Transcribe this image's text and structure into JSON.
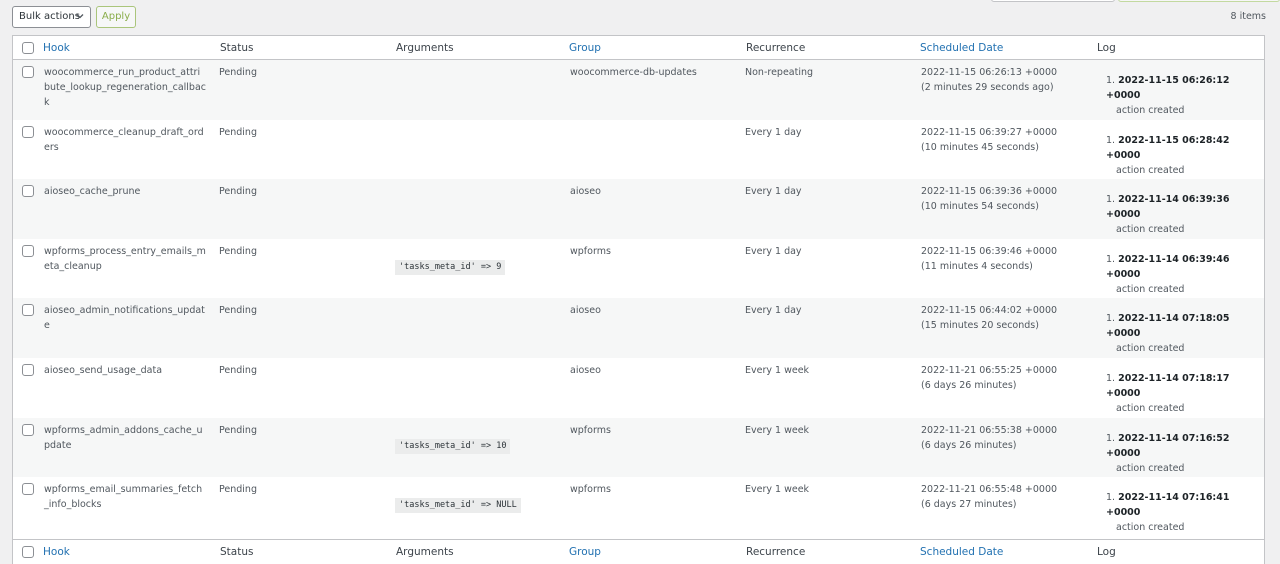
{
  "toolbar": {
    "bulk_actions_label": "Bulk actions",
    "apply_label": "Apply",
    "items_count": "8 items"
  },
  "columns": {
    "hook": "Hook",
    "status": "Status",
    "arguments": "Arguments",
    "group": "Group",
    "recurrence": "Recurrence",
    "scheduled_date": "Scheduled Date",
    "log": "Log"
  },
  "rows": [
    {
      "hook": "woocommerce_run_product_attribute_lookup_regeneration_callback",
      "status": "Pending",
      "arguments": "",
      "group": "woocommerce-db-updates",
      "recurrence": "Non-repeating",
      "scheduled": "2022-11-15 06:26:13 +0000",
      "scheduled_rel": "(2 minutes 29 seconds ago)",
      "log_number": "1.",
      "log_date": "2022-11-15 06:26:12 +0000",
      "log_msg": "action created"
    },
    {
      "hook": "woocommerce_cleanup_draft_orders",
      "status": "Pending",
      "arguments": "",
      "group": "",
      "recurrence": "Every 1 day",
      "scheduled": "2022-11-15 06:39:27 +0000",
      "scheduled_rel": "(10 minutes 45 seconds)",
      "log_number": "1.",
      "log_date": "2022-11-15 06:28:42 +0000",
      "log_msg": "action created"
    },
    {
      "hook": "aioseo_cache_prune",
      "status": "Pending",
      "arguments": "",
      "group": "aioseo",
      "recurrence": "Every 1 day",
      "scheduled": "2022-11-15 06:39:36 +0000",
      "scheduled_rel": "(10 minutes 54 seconds)",
      "log_number": "1.",
      "log_date": "2022-11-14 06:39:36 +0000",
      "log_msg": "action created"
    },
    {
      "hook": "wpforms_process_entry_emails_meta_cleanup",
      "status": "Pending",
      "arguments": "'tasks_meta_id' => 9",
      "group": "wpforms",
      "recurrence": "Every 1 day",
      "scheduled": "2022-11-15 06:39:46 +0000",
      "scheduled_rel": "(11 minutes 4 seconds)",
      "log_number": "1.",
      "log_date": "2022-11-14 06:39:46 +0000",
      "log_msg": "action created"
    },
    {
      "hook": "aioseo_admin_notifications_update",
      "status": "Pending",
      "arguments": "",
      "group": "aioseo",
      "recurrence": "Every 1 day",
      "scheduled": "2022-11-15 06:44:02 +0000",
      "scheduled_rel": "(15 minutes 20 seconds)",
      "log_number": "1.",
      "log_date": "2022-11-14 07:18:05 +0000",
      "log_msg": "action created"
    },
    {
      "hook": "aioseo_send_usage_data",
      "status": "Pending",
      "arguments": "",
      "group": "aioseo",
      "recurrence": "Every 1 week",
      "scheduled": "2022-11-21 06:55:25 +0000",
      "scheduled_rel": "(6 days 26 minutes)",
      "log_number": "1.",
      "log_date": "2022-11-14 07:18:17 +0000",
      "log_msg": "action created"
    },
    {
      "hook": "wpforms_admin_addons_cache_update",
      "status": "Pending",
      "arguments": "'tasks_meta_id' => 10",
      "group": "wpforms",
      "recurrence": "Every 1 week",
      "scheduled": "2022-11-21 06:55:38 +0000",
      "scheduled_rel": "(6 days 26 minutes)",
      "log_number": "1.",
      "log_date": "2022-11-14 07:16:52 +0000",
      "log_msg": "action created"
    },
    {
      "hook": "wpforms_email_summaries_fetch_info_blocks",
      "status": "Pending",
      "arguments": "'tasks_meta_id' => NULL",
      "group": "wpforms",
      "recurrence": "Every 1 week",
      "scheduled": "2022-11-21 06:55:48 +0000",
      "scheduled_rel": "(6 days 27 minutes)",
      "log_number": "1.",
      "log_date": "2022-11-14 07:16:41 +0000",
      "log_msg": "action created"
    }
  ]
}
